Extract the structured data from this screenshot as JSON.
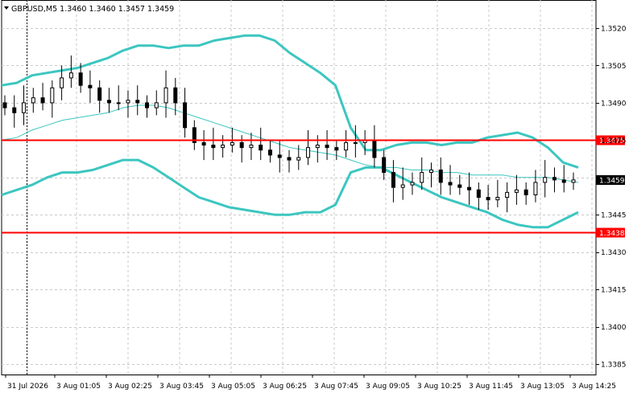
{
  "chart_data": {
    "type": "candlestick",
    "title": "GBPUSD,M5 1.3460 1.3460 1.3457 1.3459",
    "symbol": "GBPUSD",
    "timeframe": "M5",
    "ohlc_readout": [
      "1.3460",
      "1.3460",
      "1.3457",
      "1.3459"
    ],
    "current_price": "1.3459",
    "y_ticks": [
      "1.3520",
      "1.3505",
      "1.3490",
      "1.3475",
      "1.3459",
      "1.3445",
      "1.3430",
      "1.3415",
      "1.3400",
      "1.3385"
    ],
    "y_tick_values": [
      1.352,
      1.3505,
      1.349,
      1.346,
      1.3445,
      1.343,
      1.3415,
      1.34,
      1.3385
    ],
    "ylim": [
      1.338,
      1.3528
    ],
    "x_ticks": [
      "31 Jul 2026",
      "3 Aug 01:05",
      "3 Aug 02:25",
      "3 Aug 03:45",
      "3 Aug 05:05",
      "3 Aug 06:25",
      "3 Aug 07:45",
      "3 Aug 09:05",
      "3 Aug 10:25",
      "3 Aug 11:45",
      "3 Aug 13:05",
      "3 Aug 14:25"
    ],
    "horizontal_lines": [
      {
        "label": "1.3475",
        "value": 1.3475,
        "color": "#ff0000"
      },
      {
        "label": "1.3438",
        "value": 1.3438,
        "color": "#ff0000"
      }
    ],
    "grid": true,
    "bollinger_upper": [
      1.3497,
      1.3498,
      1.3501,
      1.3502,
      1.3503,
      1.3504,
      1.3506,
      1.3508,
      1.3511,
      1.3513,
      1.3513,
      1.3512,
      1.3513,
      1.3513,
      1.3515,
      1.3516,
      1.3517,
      1.3517,
      1.3515,
      1.351,
      1.3506,
      1.3502,
      1.3497,
      1.348,
      1.3471,
      1.3471,
      1.3473,
      1.3474,
      1.3474,
      1.3473,
      1.3474,
      1.3474,
      1.3476,
      1.3477,
      1.3478,
      1.3476,
      1.3472,
      1.3466,
      1.3464
    ],
    "bollinger_middle": [
      1.3475,
      1.3476,
      1.3479,
      1.3481,
      1.3483,
      1.3484,
      1.3485,
      1.3486,
      1.3488,
      1.3489,
      1.3489,
      1.3488,
      1.3486,
      1.3484,
      1.3482,
      1.348,
      1.3478,
      1.3476,
      1.3474,
      1.3472,
      1.3471,
      1.347,
      1.3469,
      1.3467,
      1.3465,
      1.3464,
      1.3464,
      1.3463,
      1.3463,
      1.3462,
      1.3462,
      1.3461,
      1.3461,
      1.3461,
      1.346,
      1.346,
      1.346,
      1.3459,
      1.3458
    ],
    "bollinger_lower": [
      1.3453,
      1.3455,
      1.3457,
      1.346,
      1.3462,
      1.3462,
      1.3463,
      1.3465,
      1.3467,
      1.3467,
      1.3464,
      1.346,
      1.3456,
      1.3452,
      1.345,
      1.3448,
      1.3447,
      1.3446,
      1.3445,
      1.3445,
      1.3446,
      1.3446,
      1.3449,
      1.3462,
      1.3464,
      1.3464,
      1.3461,
      1.3458,
      1.3455,
      1.3452,
      1.345,
      1.3448,
      1.3446,
      1.3443,
      1.3441,
      1.344,
      1.344,
      1.3443,
      1.3446
    ],
    "close": [
      1.3488,
      1.3486,
      1.349,
      1.3492,
      1.349,
      1.3496,
      1.35,
      1.3502,
      1.3497,
      1.3496,
      1.3491,
      1.349,
      1.349,
      1.3491,
      1.349,
      1.3488,
      1.349,
      1.3496,
      1.349,
      1.348,
      1.3474,
      1.3473,
      1.3472,
      1.3473,
      1.3474,
      1.3472,
      1.3473,
      1.3471,
      1.3469,
      1.3468,
      1.3467,
      1.3468,
      1.3472,
      1.3473,
      1.3472,
      1.3471,
      1.3474,
      1.3474,
      1.3475,
      1.3468,
      1.3462,
      1.3456,
      1.3457,
      1.3458,
      1.3462,
      1.3463,
      1.3458,
      1.3457,
      1.3456,
      1.3455,
      1.3452,
      1.3451,
      1.3452,
      1.3454,
      1.3455,
      1.3453,
      1.3458,
      1.346,
      1.3459,
      1.3458,
      1.3459
    ]
  }
}
